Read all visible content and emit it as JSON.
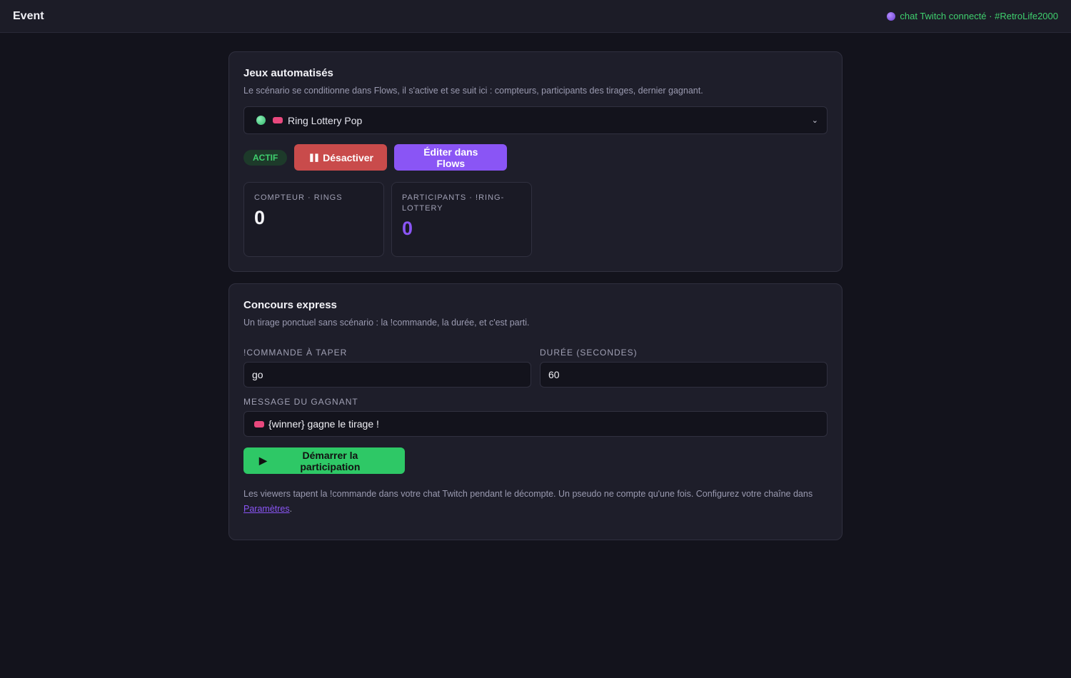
{
  "header": {
    "title": "Event",
    "status_text": "chat Twitch connecté · #RetroLife2000"
  },
  "games": {
    "title": "Jeux automatisés",
    "description": "Le scénario se conditionne dans Flows, il s'active et se suit ici : compteurs, participants des tirages, dernier gagnant.",
    "selected_game": "Ring Lottery Pop",
    "status_badge": "ACTIF",
    "deactivate_label": "Désactiver",
    "edit_label": "Éditer dans Flows",
    "counters": [
      {
        "label": "COMPTEUR · RINGS",
        "value": "0"
      },
      {
        "label": "PARTICIPANTS · !RING-LOTTERY",
        "value": "0"
      }
    ]
  },
  "express": {
    "title": "Concours express",
    "description": "Un tirage ponctuel sans scénario : la !commande, la durée, et c'est parti.",
    "command_label": "!COMMANDE À TAPER",
    "command_value": "go",
    "duration_label": "DURÉE (SECONDES)",
    "duration_value": "60",
    "winner_label": "MESSAGE DU GAGNANT",
    "winner_value": "{winner} gagne le tirage !",
    "start_label": "Démarrer la participation",
    "note_text": "Les viewers tapent la !commande dans votre chat Twitch pendant le décompte. Un pseudo ne compte qu'une fois. Configurez votre chaîne dans ",
    "note_link": "Paramètres",
    "note_end": "."
  },
  "colors": {
    "accent": "#8a55f5",
    "success": "#2ec866",
    "danger": "#c94b4b",
    "background": "#13131c"
  },
  "icons": {
    "status": "twitch-dot-icon",
    "game_status": "green-dot-icon",
    "game_tag": "pink-tag-icon",
    "dropdown": "chevron-down-icon",
    "deactivate": "pause-icon",
    "start": "play-icon"
  }
}
